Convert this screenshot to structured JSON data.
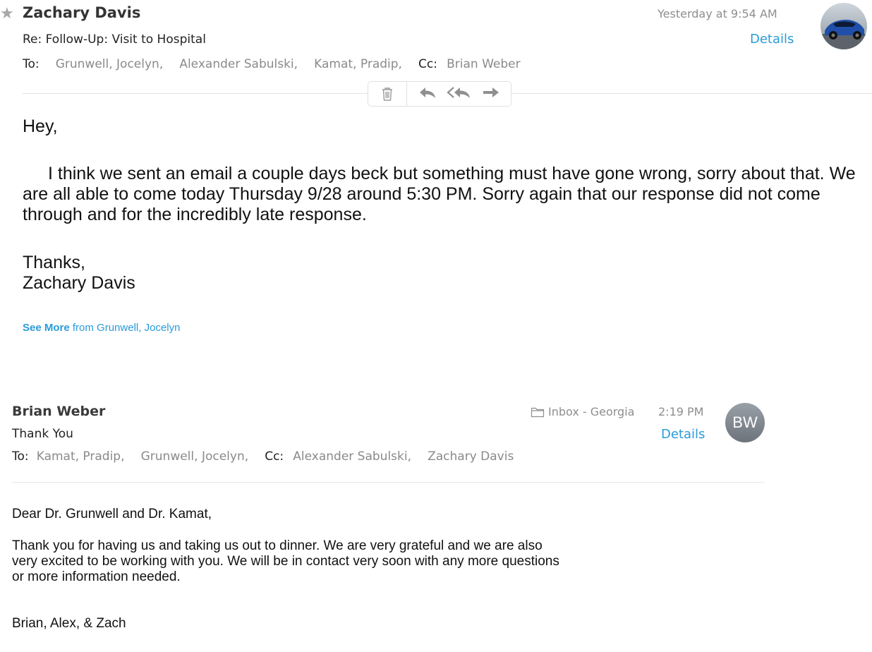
{
  "message1": {
    "sender": "Zachary Davis",
    "subject": "Re: Follow-Up: Visit to Hospital",
    "to_label": "To:",
    "to": [
      "Grunwell, Jocelyn,",
      "Alexander Sabulski,",
      "Kamat, Pradip,"
    ],
    "cc_label": "Cc:",
    "cc": [
      "Brian Weber"
    ],
    "date": "Yesterday at 9:54 AM",
    "details_label": "Details",
    "body": {
      "greeting": "Hey,",
      "paragraph": "I think we sent an email a couple days beck but something must have gone wrong, sorry about that.  We are all able to come today Thursday 9/28 around 5:30 PM.  Sorry again that our response did not come through and for the incredibly late response.",
      "signoff": "Thanks,",
      "signature": "Zachary Davis"
    },
    "see_more_bold": "See More",
    "see_more_rest": "from Grunwell, Jocelyn"
  },
  "toolbar": {
    "icons": [
      "trash-icon",
      "reply-icon",
      "reply-all-icon",
      "forward-icon"
    ]
  },
  "message2": {
    "sender": "Brian Weber",
    "subject": "Thank You",
    "to_label": "To:",
    "to": [
      "Kamat, Pradip,",
      "Grunwell, Jocelyn,"
    ],
    "cc_label": "Cc:",
    "cc": [
      "Alexander Sabulski,",
      "Zachary Davis"
    ],
    "folder": "Inbox - Georgia",
    "time": "2:19 PM",
    "details_label": "Details",
    "avatar_initials": "BW",
    "body": {
      "greeting": "Dear Dr. Grunwell and Dr. Kamat,",
      "paragraph": "Thank you for having us and taking us out to dinner. We are very grateful and we are also very excited to be working with you. We will be in contact very soon with any more questions or more information needed.",
      "signature": "Brian, Alex, & Zach"
    }
  },
  "colors": {
    "link": "#2a9bd8",
    "muted": "#8e8e8e",
    "avatar_bg": "#7d838b"
  }
}
